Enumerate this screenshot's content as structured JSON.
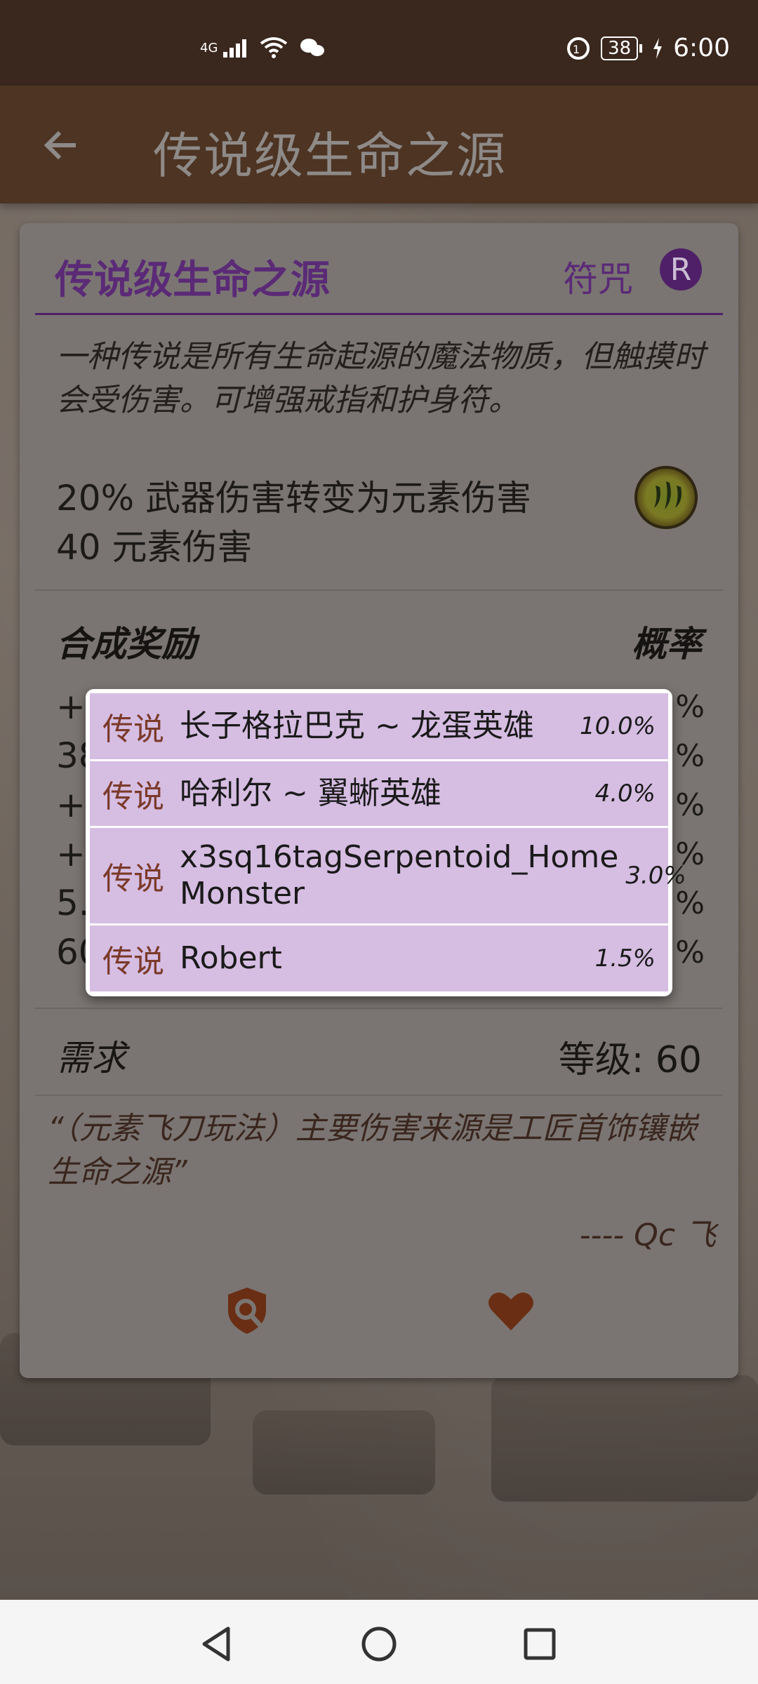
{
  "status": {
    "network": "4G",
    "battery": "38",
    "time": "6:00"
  },
  "appbar": {
    "title": "传说级生命之源"
  },
  "card": {
    "title": "传说级生命之源",
    "type": "符咒",
    "rarity_badge": "R",
    "description": "一种传说是所有生命起源的魔法物质，但触摸时会受伤害。可增强戒指和护身符。",
    "stats": [
      "20% 武器伤害转变为元素伤害",
      "40 元素伤害"
    ],
    "rewards_header": "合成奖励",
    "probability_header": "概率",
    "rewards_partial": [
      {
        "prefix": "+2",
        "pct_suffix": "%"
      },
      {
        "prefix": "38",
        "pct_suffix": "%"
      },
      {
        "prefix": "+5",
        "pct_suffix": "%"
      },
      {
        "prefix": "+5",
        "pct_suffix": "%"
      },
      {
        "prefix": "5.",
        "pct_suffix": "%"
      },
      {
        "prefix": "60",
        "pct_suffix": "%"
      }
    ],
    "requirement_label": "需求",
    "requirement_value": "等级: 60",
    "quote": "“（元素飞刀玩法）主要伤害来源是工匠首饰镶嵌生命之源”",
    "quote_author": "---- Qc 飞"
  },
  "popup": {
    "items": [
      {
        "tag": "传说",
        "name": "长子格拉巴克 ~ 龙蛋英雄",
        "pct": "10.0%"
      },
      {
        "tag": "传说",
        "name": "哈利尔 ~  翼蜥英雄",
        "pct": "4.0%"
      },
      {
        "tag": "传说",
        "name": "x3sq16tagSerpentoid_Home Monster",
        "pct": "3.0%"
      },
      {
        "tag": "传说",
        "name": "Robert",
        "pct": "1.5%"
      }
    ]
  },
  "colors": {
    "appbar": "#4d3423",
    "statusbar": "#3a271d",
    "accent_purple": "#5b2a77",
    "popup_row": "#d6bde2",
    "icon_brown": "#6a2e14"
  }
}
